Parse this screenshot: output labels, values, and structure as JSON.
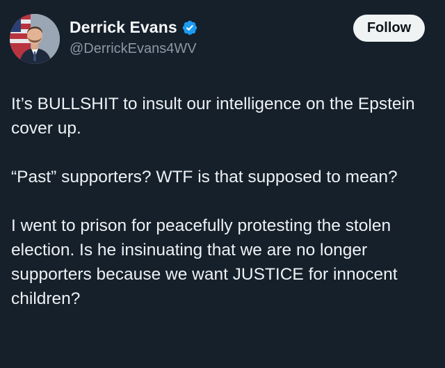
{
  "author": {
    "display_name": "Derrick Evans",
    "handle": "@DerrickEvans4WV",
    "verified": true,
    "verified_color": "#1d9bf0"
  },
  "actions": {
    "follow_label": "Follow"
  },
  "tweet": {
    "paragraphs": [
      "It’s BULLSHIT to insult our intelligence on the Epstein cover up.",
      "“Past” supporters? WTF is that supposed to mean?",
      "I went to prison for peacefully protesting the stolen election. Is he insinuating that we are no longer supporters because we want JUSTICE for innocent children?"
    ]
  },
  "theme": {
    "background": "#15202b",
    "text": "#eef1f4",
    "secondary_text": "#8b98a5",
    "button_bg": "#eff3f4"
  },
  "icons": {
    "avatar": "profile-photo",
    "verified": "verified-badge-icon"
  }
}
